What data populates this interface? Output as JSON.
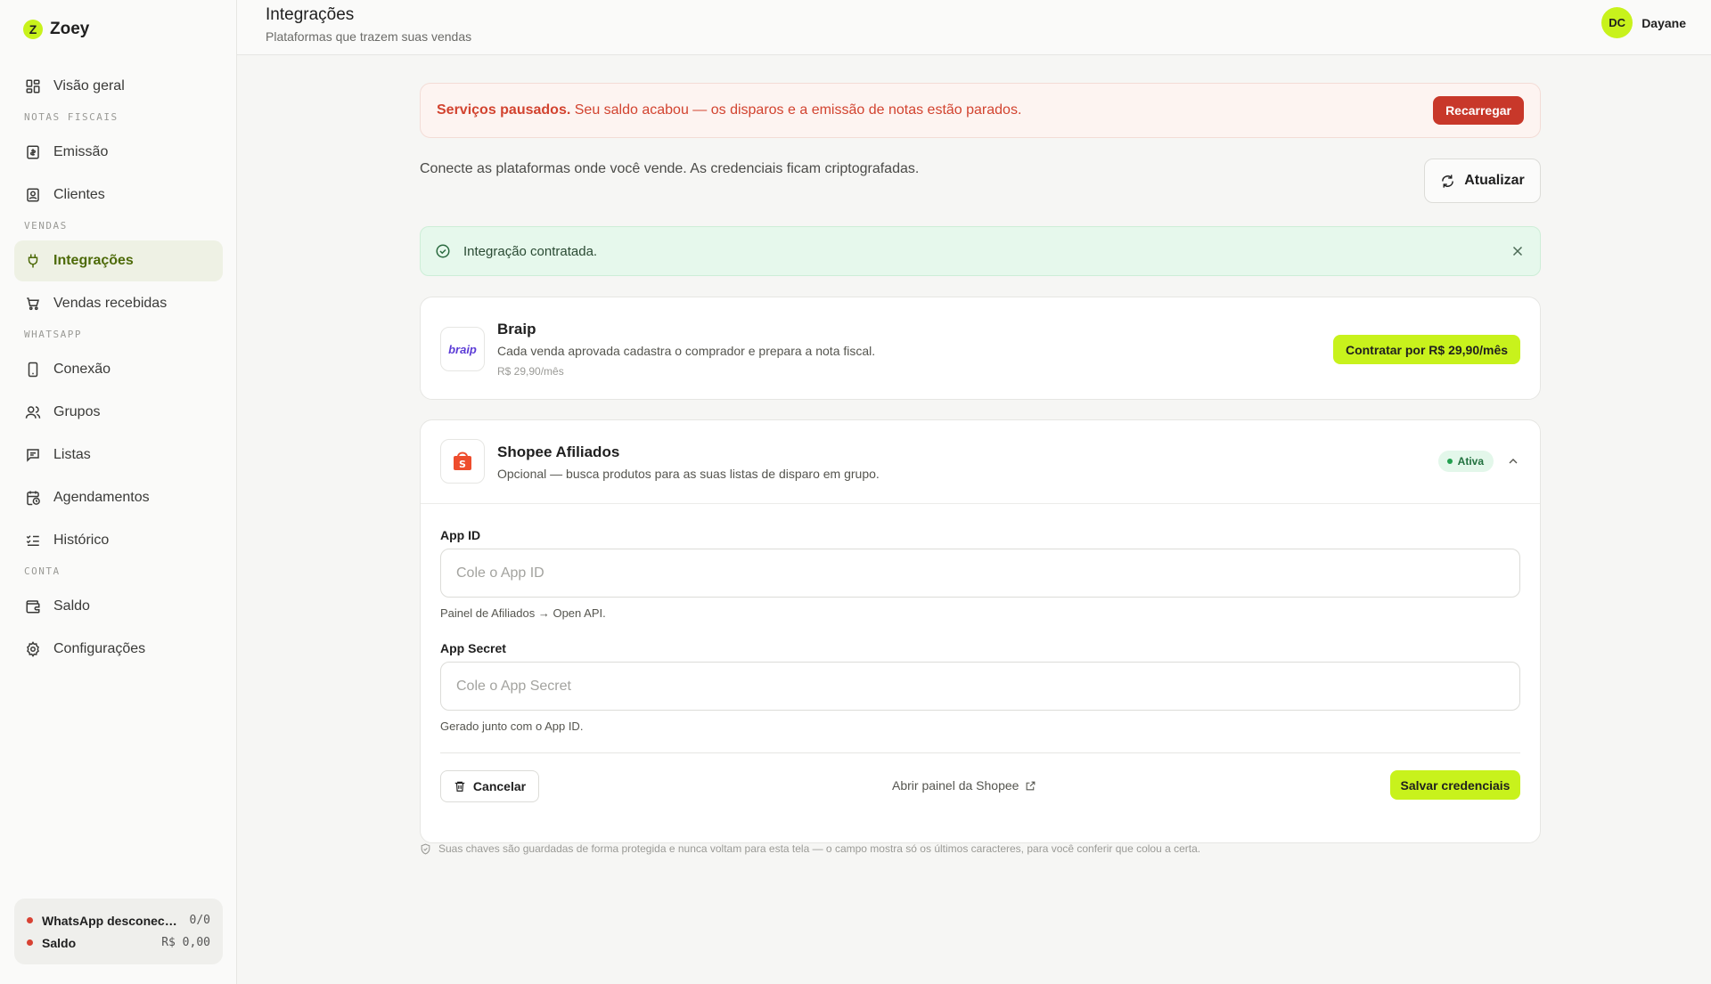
{
  "brand": {
    "name": "Zoey",
    "logo_letter": "Z"
  },
  "sidebar": {
    "overview": "Visão geral",
    "sections": {
      "notas": "NOTAS FISCAIS",
      "vendas": "VENDAS",
      "whatsapp": "WHATSAPP",
      "conta": "CONTA"
    },
    "items": {
      "emissao": "Emissão",
      "clientes": "Clientes",
      "integracoes": "Integrações",
      "vendas_recebidas": "Vendas recebidas",
      "conexao": "Conexão",
      "grupos": "Grupos",
      "listas": "Listas",
      "agendamentos": "Agendamentos",
      "historico": "Histórico",
      "saldo": "Saldo",
      "configuracoes": "Configurações"
    },
    "status": {
      "whatsapp_label": "WhatsApp desconectado",
      "whatsapp_value": "0/0",
      "saldo_label": "Saldo",
      "saldo_value": "R$ 0,00",
      "dot_color": "#d84233"
    }
  },
  "header": {
    "title": "Integrações",
    "subtitle": "Plataformas que trazem suas vendas",
    "user": {
      "initials": "DC",
      "name": "Dayane"
    }
  },
  "alert": {
    "bold": "Serviços pausados.",
    "text": " Seu saldo acabou — os disparos e a emissão de notas estão parados.",
    "button": "Recarregar"
  },
  "intro": {
    "text": "Conecte as plataformas onde você vende. As credenciais ficam criptografadas.",
    "refresh_button": "Atualizar"
  },
  "success": {
    "text": "Integração contratada."
  },
  "braip": {
    "logo_text": "braip",
    "title": "Braip",
    "description": "Cada venda aprovada cadastra o comprador e prepara a nota fiscal.",
    "price": "R$ 29,90/mês",
    "button": "Contratar por R$ 29,90/mês"
  },
  "shopee": {
    "logo_letter": "S",
    "title": "Shopee Afiliados",
    "description": "Opcional — busca produtos para as suas listas de disparo em grupo.",
    "badge": "Ativa",
    "app_id": {
      "label": "App ID",
      "placeholder": "Cole o App ID",
      "hint": "Painel de Afiliados → Open API."
    },
    "app_secret": {
      "label": "App Secret",
      "placeholder": "Cole o App Secret",
      "hint": "Gerado junto com o App ID."
    },
    "cancel_button": "Cancelar",
    "panel_link": "Abrir painel da Shopee",
    "save_button": "Salvar credenciais"
  },
  "footnote": "Suas chaves são guardadas de forma protegida e nunca voltam para esta tela — o campo mostra só os últimos caracteres, para você conferir que colou a certa.",
  "colors": {
    "accent": "#c8f21c",
    "danger": "#c8382a",
    "success_bg": "#e6f8ec",
    "active_nav": "#4d6a08"
  }
}
